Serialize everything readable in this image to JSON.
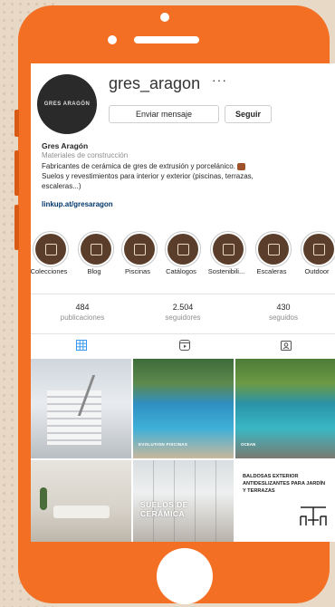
{
  "profile": {
    "username": "gres_aragon",
    "more_label": "···",
    "avatar_text": "GRES ARAGÓN",
    "message_button": "Enviar mensaje",
    "follow_button": "Seguir",
    "display_name": "Gres Aragón",
    "category": "Materiales de construcción",
    "bio_line1": "Fabricantes de cerámica de gres de extrusión y porcelánico.",
    "bio_line2": "Suelos y revestimientos para interior y exterior (piscinas, terrazas,",
    "bio_line3": "escaleras...)",
    "link": "linkup.at/gresaragon"
  },
  "highlights": [
    {
      "label": "Colecciones"
    },
    {
      "label": "Blog"
    },
    {
      "label": "Piscinas"
    },
    {
      "label": "Catálogos"
    },
    {
      "label": "Sostenibili..."
    },
    {
      "label": "Escaleras"
    },
    {
      "label": "Outdoor"
    }
  ],
  "stats": [
    {
      "value": "484",
      "label": "publicaciones"
    },
    {
      "value": "2.504",
      "label": "seguidores"
    },
    {
      "value": "430",
      "label": "seguidos"
    }
  ],
  "tabs": {
    "posts_icon": "grid-icon",
    "reels_icon": "reels-icon",
    "tagged_icon": "tagged-icon",
    "active_color": "#3897f0"
  },
  "posts": [
    {
      "caption": ""
    },
    {
      "caption": "EVOLUTION PISCINAS"
    },
    {
      "caption": "OCEAN"
    },
    {
      "caption": ""
    },
    {
      "caption": "SUELOS DE CERÁMICA"
    },
    {
      "caption": "BALDOSAS EXTERIOR ANTIDESLIZANTES PARA JARDÍN Y TERRAZAS"
    }
  ],
  "colors": {
    "phone": "#f26f23",
    "highlight_fill": "#5a3e2b",
    "link": "#00376b"
  }
}
